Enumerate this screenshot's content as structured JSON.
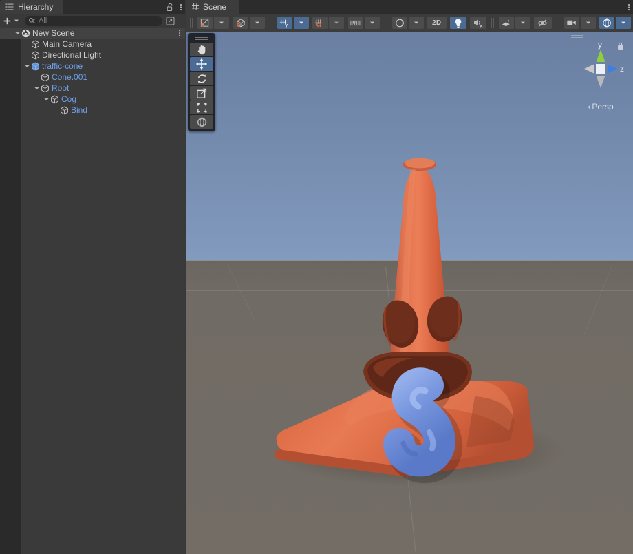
{
  "hierarchy": {
    "tab": {
      "label": "Hierarchy",
      "icon": "hierarchy-list-icon"
    },
    "lock_icon": "lock-open-icon",
    "menu_icon": "kebab-menu-icon",
    "toolbar": {
      "add_label": "+",
      "add_dropdown_icon": "chevron-down-icon",
      "search_icon": "search-icon",
      "search_value": "",
      "search_placeholder": "All",
      "search_expand_icon": "expand-search-icon"
    },
    "items": [
      {
        "label": "New Scene",
        "icon": "unity-scene-icon",
        "depth": 0,
        "expanded": true,
        "color": "white",
        "selected": true,
        "has_menu": true
      },
      {
        "label": "Main Camera",
        "icon": "gameobject-cube-icon",
        "depth": 1,
        "expanded": null,
        "color": "white",
        "selected": false,
        "has_menu": false
      },
      {
        "label": "Directional Light",
        "icon": "gameobject-cube-icon",
        "depth": 1,
        "expanded": null,
        "color": "white",
        "selected": false,
        "has_menu": false
      },
      {
        "label": "traffic-cone",
        "icon": "prefab-cube-icon",
        "depth": 1,
        "expanded": true,
        "color": "blue",
        "selected": false,
        "has_menu": false
      },
      {
        "label": "Cone.001",
        "icon": "gameobject-cube-icon",
        "depth": 2,
        "expanded": null,
        "color": "blue",
        "selected": false,
        "has_menu": false
      },
      {
        "label": "Root",
        "icon": "gameobject-cube-icon",
        "depth": 2,
        "expanded": true,
        "color": "blue",
        "selected": false,
        "has_menu": false
      },
      {
        "label": "Cog",
        "icon": "gameobject-cube-icon",
        "depth": 3,
        "expanded": true,
        "color": "blue",
        "selected": false,
        "has_menu": false
      },
      {
        "label": "Bind",
        "icon": "gameobject-cube-icon",
        "depth": 4,
        "expanded": null,
        "color": "blue",
        "selected": false,
        "has_menu": false
      }
    ]
  },
  "scene": {
    "tab": {
      "label": "Scene",
      "icon": "scene-grid-icon"
    },
    "menu_icon": "kebab-menu-icon",
    "toolbar_left": [
      {
        "name": "pivot-mode-button",
        "icon": "pivot-center-icon",
        "active": false,
        "dropdown": true,
        "label": ""
      },
      {
        "name": "handle-space-button",
        "icon": "global-local-icon",
        "active": false,
        "dropdown": true,
        "label": ""
      },
      {
        "name": "grid-snap-button",
        "icon": "grid-axis-y-icon",
        "active": true,
        "dropdown": true,
        "label": ""
      },
      {
        "name": "snap-increment-button",
        "icon": "grid-snap-icon",
        "active": false,
        "dropdown": true,
        "label": ""
      },
      {
        "name": "grid-size-button",
        "icon": "grid-ruler-icon",
        "active": false,
        "dropdown": true,
        "label": ""
      }
    ],
    "toolbar_right": [
      {
        "name": "draw-mode-button",
        "icon": "shaded-sphere-icon",
        "active": false,
        "dropdown": true,
        "label": ""
      },
      {
        "name": "2d-toggle-button",
        "icon": "",
        "active": false,
        "dropdown": false,
        "label": "2D"
      },
      {
        "name": "lighting-toggle-button",
        "icon": "lightbulb-icon",
        "active": true,
        "dropdown": false,
        "label": ""
      },
      {
        "name": "audio-toggle-button",
        "icon": "speaker-mute-icon",
        "active": false,
        "dropdown": false,
        "label": ""
      },
      {
        "name": "effects-button",
        "icon": "fx-sparkle-icon",
        "active": false,
        "dropdown": true,
        "label": ""
      },
      {
        "name": "hidden-objects-button",
        "icon": "eye-slash-icon",
        "active": false,
        "dropdown": false,
        "label": ""
      },
      {
        "name": "scene-camera-button",
        "icon": "camera-icon",
        "active": false,
        "dropdown": true,
        "label": ""
      },
      {
        "name": "gizmos-toggle-button",
        "icon": "gizmos-globe-icon",
        "active": true,
        "dropdown": true,
        "label": ""
      }
    ],
    "tool_palette": [
      {
        "name": "hand-tool",
        "icon": "hand-icon",
        "active": false
      },
      {
        "name": "move-tool",
        "icon": "move-arrows-icon",
        "active": true
      },
      {
        "name": "rotate-tool",
        "icon": "rotate-icon",
        "active": false
      },
      {
        "name": "scale-tool",
        "icon": "scale-icon",
        "active": false
      },
      {
        "name": "rect-tool",
        "icon": "rect-transform-icon",
        "active": false
      },
      {
        "name": "transform-tool",
        "icon": "transform-globe-icon",
        "active": false
      }
    ],
    "gizmo": {
      "projection_label": "Persp",
      "projection_icon": "chevron-left-icon",
      "axis_y_label": "y",
      "axis_z_label": "z",
      "lock_icon": "lock-icon",
      "color_y": "#8ece3f",
      "color_z": "#3f7fe0",
      "color_neutral": "#c9c9c9"
    },
    "viewport": {
      "object_label": "traffic-cone",
      "cone_color": "#e06a44",
      "cone_shadow_color": "#8c3c25",
      "tongue_color": "#6f90dd",
      "sky_top_color": "#6a7fa2",
      "sky_horizon_color": "#dff0ef",
      "ground_color": "#716b65"
    }
  }
}
